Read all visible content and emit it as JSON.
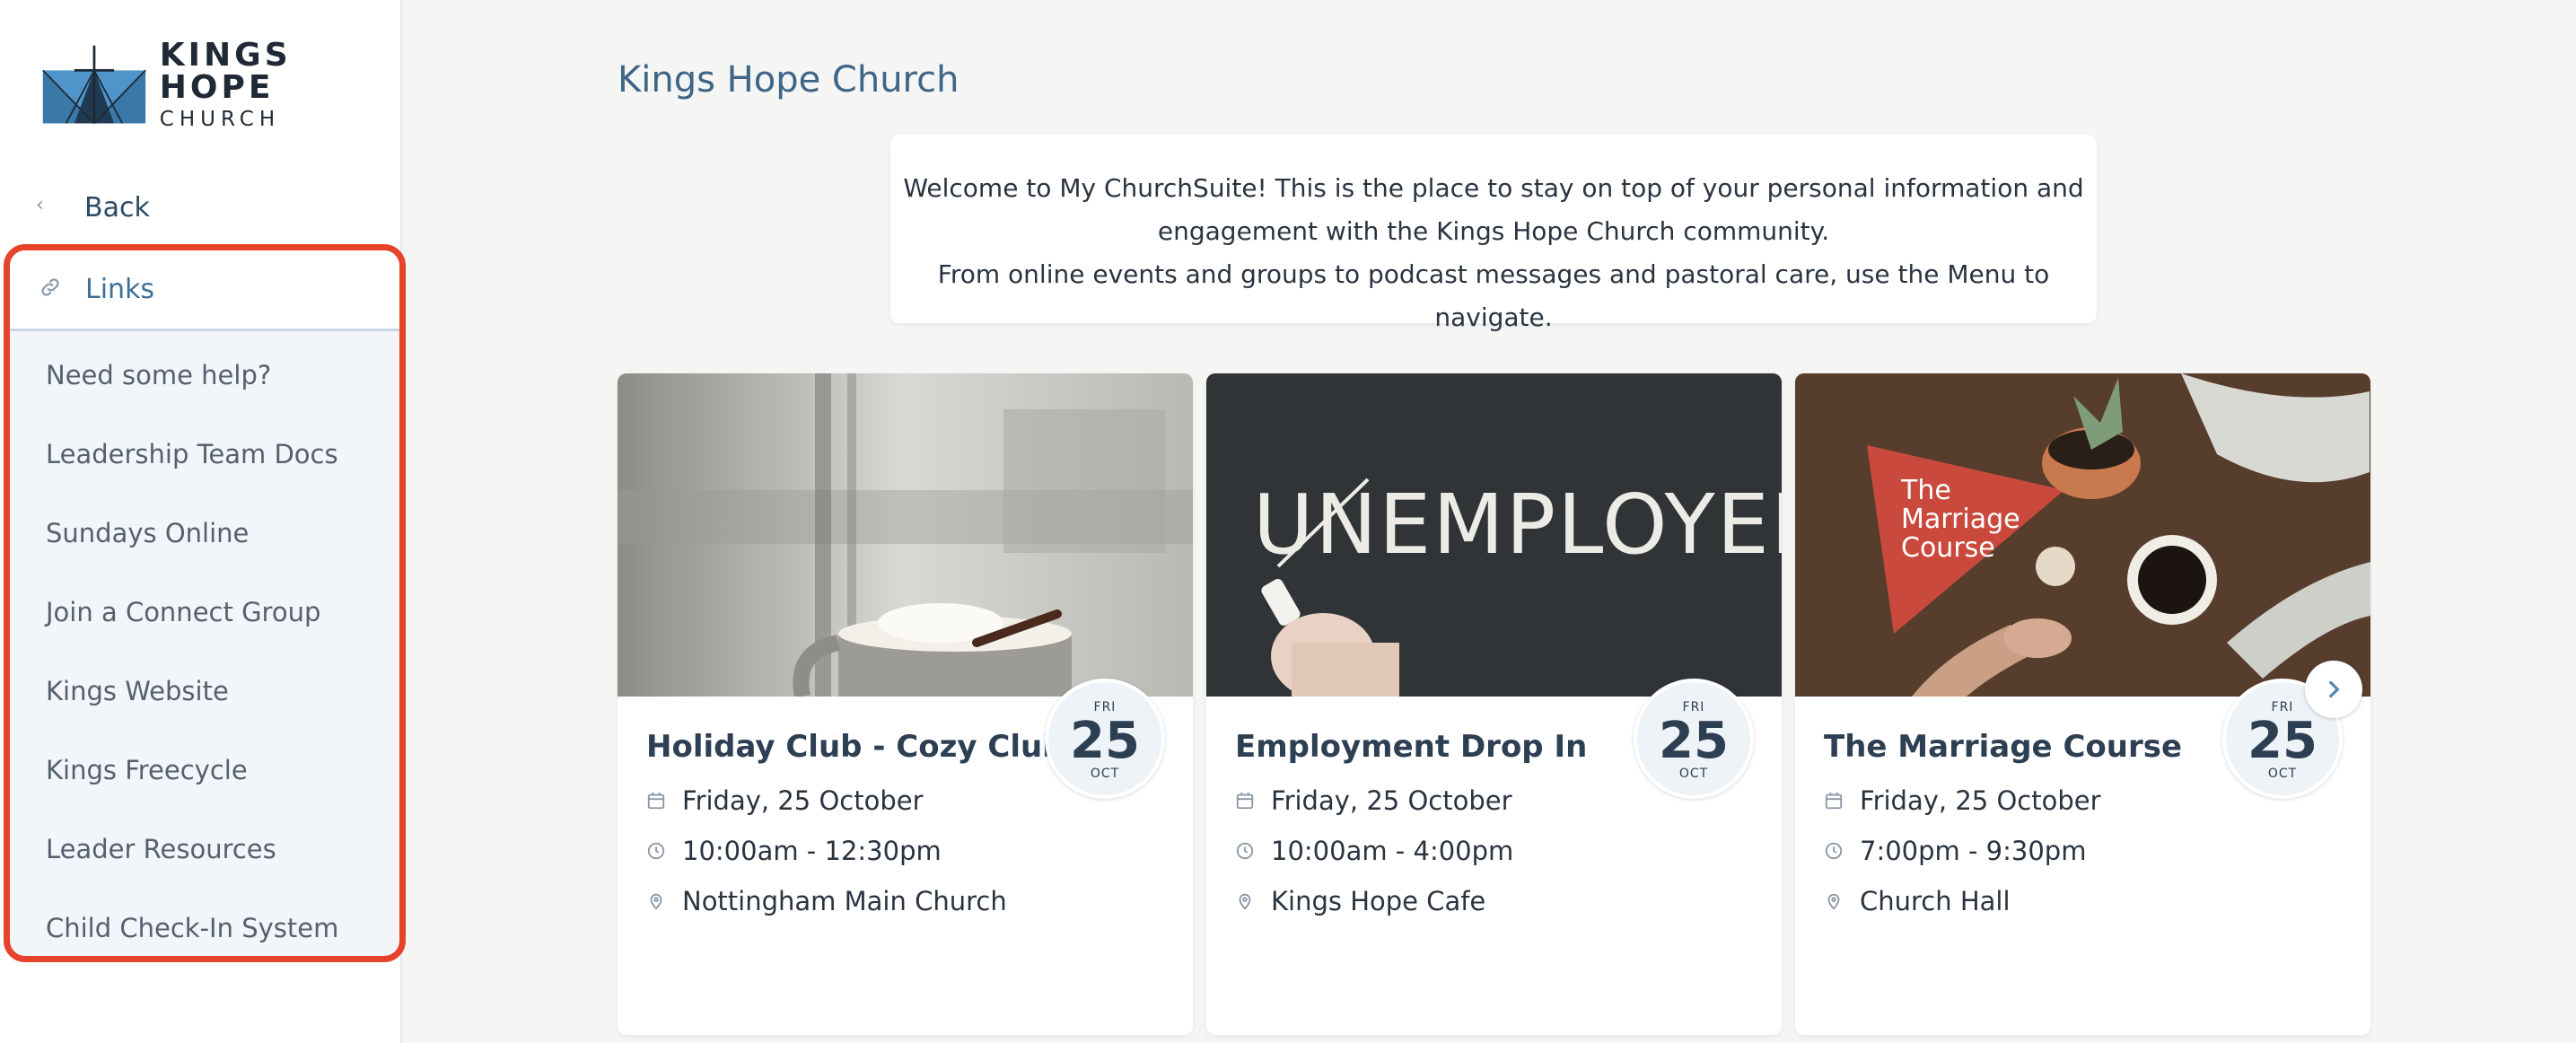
{
  "brand": {
    "name": "KINGS HOPE",
    "subtitle": "CHURCH"
  },
  "sidebar": {
    "back_label": "Back",
    "links_header": "Links",
    "links": [
      "Need some help?",
      "Leadership Team Docs",
      "Sundays Online",
      "Join a Connect Group",
      "Kings Website",
      "Kings Freecycle",
      "Leader Resources",
      "Child Check-In System"
    ]
  },
  "main": {
    "title": "Kings Hope Church",
    "welcome": [
      "Welcome to My ChurchSuite! This is the place to stay on top of your personal information and",
      "engagement with the Kings Hope Church community.",
      "From online events and groups to podcast messages and pastoral care, use the Menu to navigate."
    ],
    "events": [
      {
        "title": "Holiday Club - Cozy Club!",
        "date": "Friday, 25 October",
        "time": "10:00am - 12:30pm",
        "location": "Nottingham Main Church",
        "badge": {
          "dow": "FRI",
          "day": "25",
          "month": "OCT"
        }
      },
      {
        "title": "Employment Drop In",
        "date": "Friday, 25 October",
        "time": "10:00am - 4:00pm",
        "location": "Kings Hope Cafe",
        "badge": {
          "dow": "FRI",
          "day": "25",
          "month": "OCT"
        },
        "image_text": "UNEMPLOYED"
      },
      {
        "title": "The Marriage Course",
        "date": "Friday, 25 October",
        "time": "7:00pm - 9:30pm",
        "location": "Church Hall",
        "badge": {
          "dow": "FRI",
          "day": "25",
          "month": "OCT"
        },
        "image_text": [
          "The",
          "Marriage",
          "Course"
        ]
      }
    ]
  },
  "colors": {
    "accent": "#3d6587",
    "highlight_border": "#e5432a",
    "page_bg": "#f5f5f4"
  }
}
